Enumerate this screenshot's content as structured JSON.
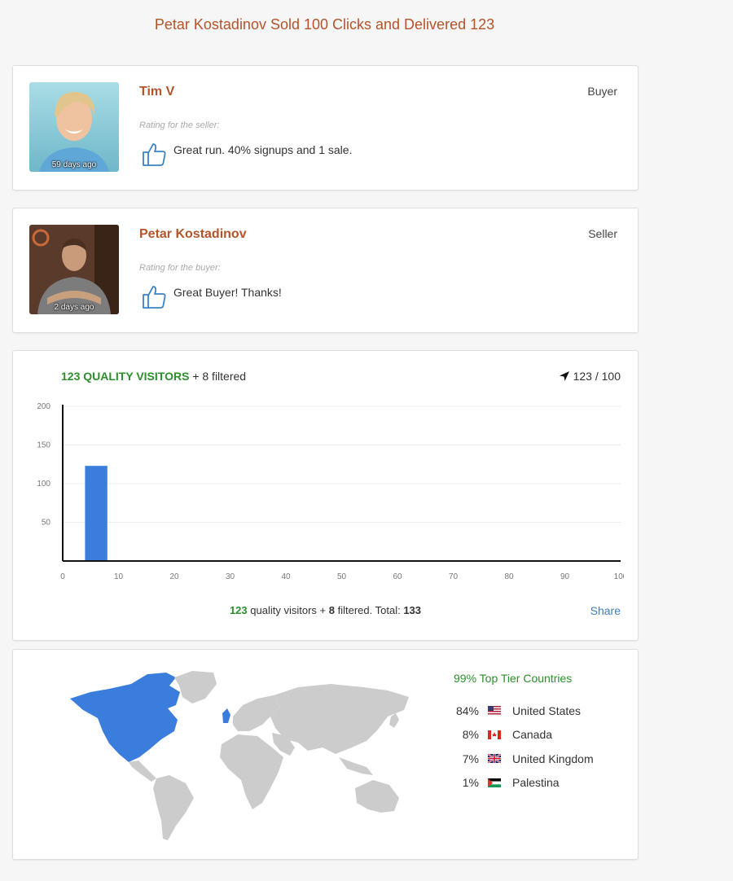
{
  "page": {
    "title": "Petar Kostadinov Sold 100 Clicks and Delivered 123"
  },
  "reviews": [
    {
      "name": "Tim V",
      "role": "Buyer",
      "rating_label": "Rating for the seller:",
      "comment": "Great run. 40% signups and 1 sale.",
      "ago": "59 days ago",
      "icon": "thumbs-up-icon"
    },
    {
      "name": "Petar Kostadinov",
      "role": "Seller",
      "rating_label": "Rating for the buyer:",
      "comment": "Great Buyer! Thanks!",
      "ago": "2 days ago",
      "icon": "thumbs-up-icon"
    }
  ],
  "stats": {
    "quality_count": "123",
    "quality_label": "QUALITY VISITORS",
    "filtered_text": "+ 8 filtered",
    "delivered": "123 / 100",
    "footer_quality": "123",
    "footer_quality_text": "quality visitors +",
    "footer_filtered": "8",
    "footer_filtered_text": "filtered. Total:",
    "footer_total": "133",
    "share_label": "Share"
  },
  "chart_data": {
    "type": "bar",
    "x": [
      6
    ],
    "values": [
      123
    ],
    "xlim": [
      0,
      100
    ],
    "ylim": [
      0,
      200
    ],
    "xticks": [
      "0",
      "10",
      "20",
      "30",
      "40",
      "50",
      "60",
      "70",
      "80",
      "90",
      "100"
    ],
    "yticks": [
      "50",
      "100",
      "150",
      "200"
    ],
    "bar_width": 4,
    "grid": true,
    "color": "#3b7ddd"
  },
  "geo": {
    "tier_title": "99% Top Tier Countries",
    "map_highlight_color": "#3b7ddd",
    "map_land_color": "#cccccc",
    "countries": [
      {
        "pct": "84%",
        "name": "United States",
        "flag": "us-flag-icon"
      },
      {
        "pct": "8%",
        "name": "Canada",
        "flag": "ca-flag-icon"
      },
      {
        "pct": "7%",
        "name": "United Kingdom",
        "flag": "gb-flag-icon"
      },
      {
        "pct": "1%",
        "name": "Palestina",
        "flag": "ps-flag-icon"
      }
    ]
  },
  "colors": {
    "title": "#b5532a",
    "quality": "#2c8f2c",
    "link": "#3a82c4",
    "bar": "#3b7ddd"
  }
}
